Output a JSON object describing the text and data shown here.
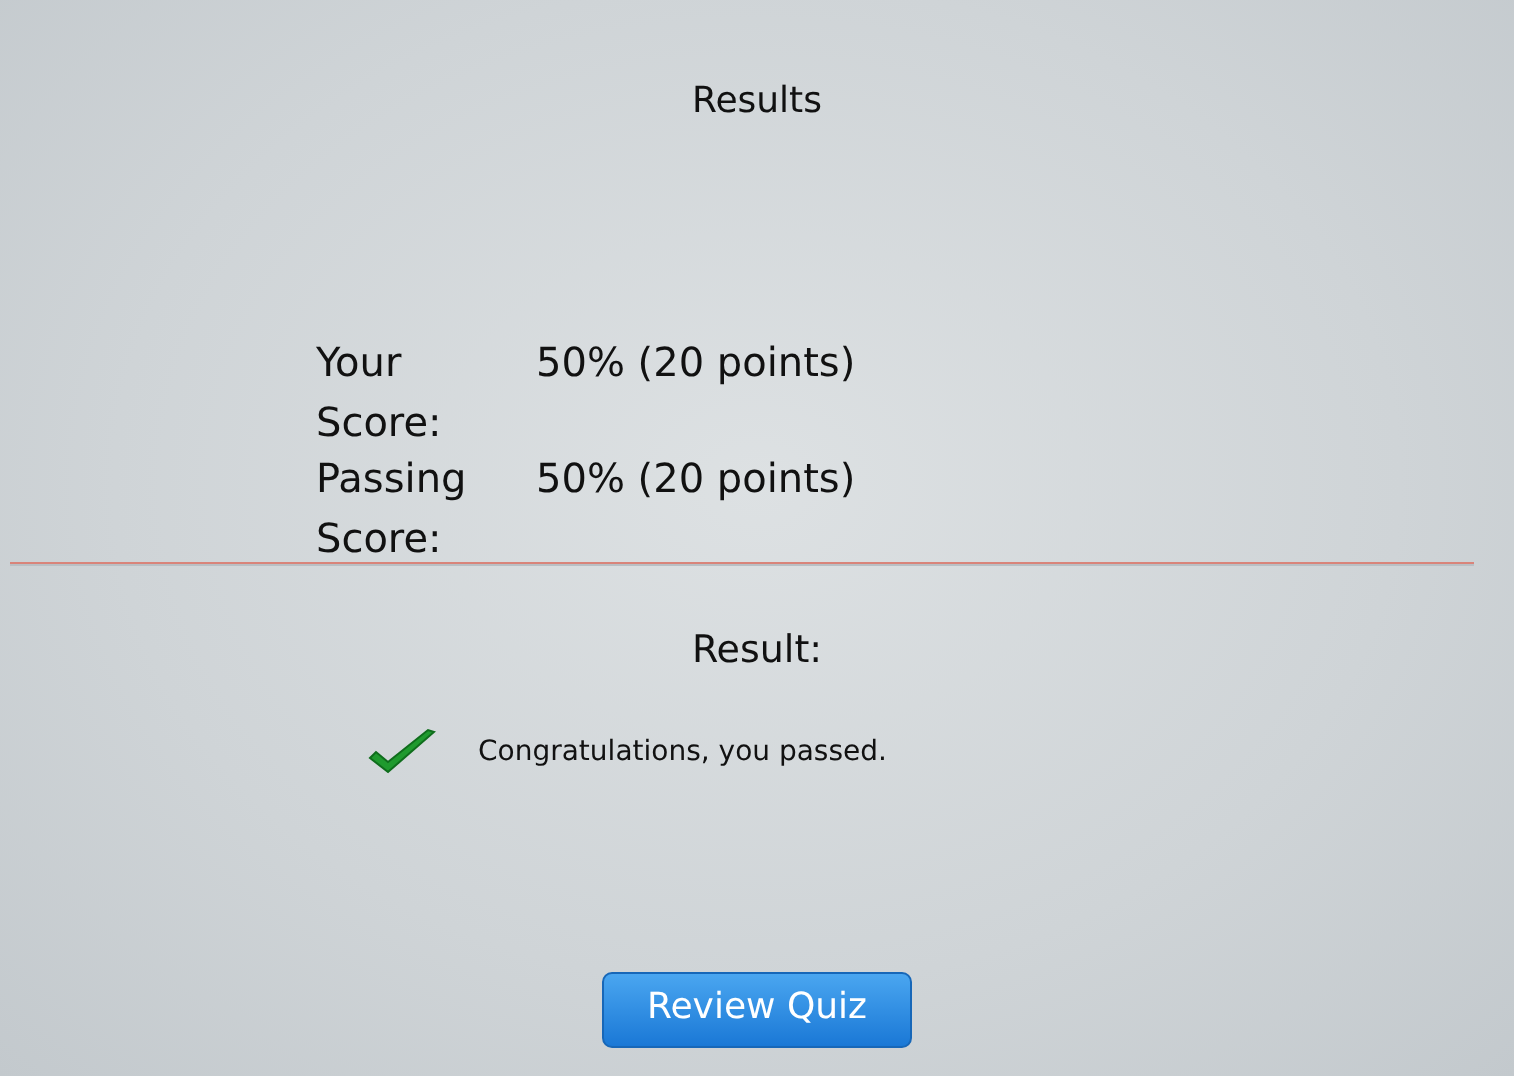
{
  "title": "Results",
  "scores": [
    {
      "label": "Your Score:",
      "value": "50% (20 points)"
    },
    {
      "label": "Passing Score:",
      "value": "50% (20 points)"
    }
  ],
  "result": {
    "heading": "Result:",
    "passed": true,
    "message": "Congratulations, you passed."
  },
  "button": {
    "label": "Review Quiz"
  }
}
